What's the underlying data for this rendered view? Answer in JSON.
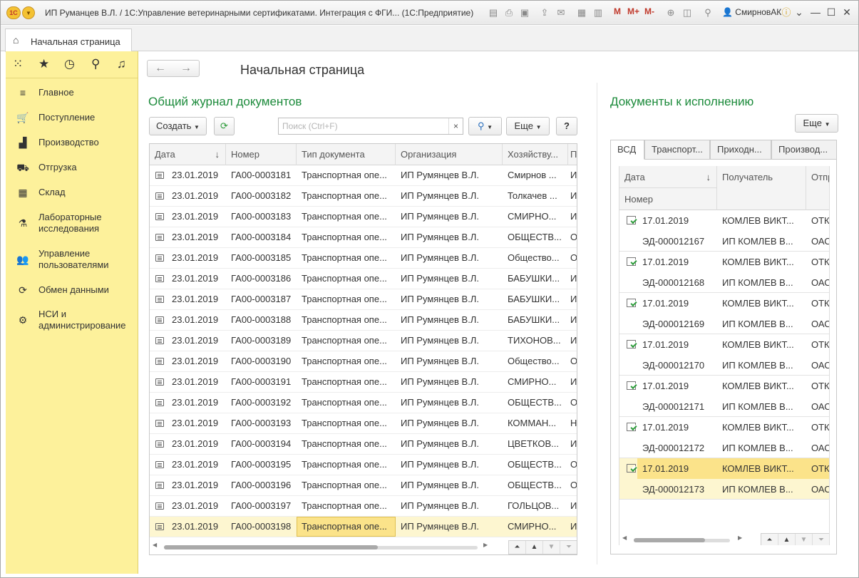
{
  "window": {
    "title": "ИП Руманцев В.Л. / 1С:Управление ветеринарными сертификатами. Интеграция с ФГИ... (1С:Предприятие)",
    "logo": "1С",
    "user": "СмирновАК",
    "toolbar_memory": [
      "M",
      "M+",
      "M-"
    ]
  },
  "tabs": {
    "home_label": "Начальная страница"
  },
  "sidebar": {
    "items": [
      {
        "label": "Главное",
        "icon": "menu-icon"
      },
      {
        "label": "Поступление",
        "icon": "cart-icon"
      },
      {
        "label": "Производство",
        "icon": "factory-icon"
      },
      {
        "label": "Отгрузка",
        "icon": "truck-icon"
      },
      {
        "label": "Склад",
        "icon": "warehouse-icon"
      },
      {
        "label": "Лабораторные исследования",
        "icon": "flask-icon"
      },
      {
        "label": "Управление пользователями",
        "icon": "users-icon"
      },
      {
        "label": "Обмен данными",
        "icon": "sync-icon"
      },
      {
        "label": "НСИ и администрирование",
        "icon": "gear-icon"
      }
    ]
  },
  "main": {
    "page_title": "Начальная страница",
    "journal": {
      "heading": "Общий журнал документов",
      "create_label": "Создать",
      "search_placeholder": "Поиск (Ctrl+F)",
      "more_label": "Еще",
      "help_label": "?",
      "columns": [
        "Дата",
        "Номер",
        "Тип документа",
        "Организация",
        "Хозяйству...",
        "П"
      ],
      "rows": [
        {
          "date": "23.01.2019",
          "number": "ГА00-0003181",
          "type": "Транспортная опе...",
          "org": "ИП Румянцев В.Л.",
          "holder": "Смирнов ...",
          "extra": "И"
        },
        {
          "date": "23.01.2019",
          "number": "ГА00-0003182",
          "type": "Транспортная опе...",
          "org": "ИП Румянцев В.Л.",
          "holder": "Толкачев ...",
          "extra": "И"
        },
        {
          "date": "23.01.2019",
          "number": "ГА00-0003183",
          "type": "Транспортная опе...",
          "org": "ИП Румянцев В.Л.",
          "holder": "СМИРНО...",
          "extra": "И"
        },
        {
          "date": "23.01.2019",
          "number": "ГА00-0003184",
          "type": "Транспортная опе...",
          "org": "ИП Румянцев В.Л.",
          "holder": "ОБЩЕСТВ...",
          "extra": "О"
        },
        {
          "date": "23.01.2019",
          "number": "ГА00-0003185",
          "type": "Транспортная опе...",
          "org": "ИП Румянцев В.Л.",
          "holder": "Общество...",
          "extra": "О"
        },
        {
          "date": "23.01.2019",
          "number": "ГА00-0003186",
          "type": "Транспортная опе...",
          "org": "ИП Румянцев В.Л.",
          "holder": "БАБУШКИ...",
          "extra": "И"
        },
        {
          "date": "23.01.2019",
          "number": "ГА00-0003187",
          "type": "Транспортная опе...",
          "org": "ИП Румянцев В.Л.",
          "holder": "БАБУШКИ...",
          "extra": "И"
        },
        {
          "date": "23.01.2019",
          "number": "ГА00-0003188",
          "type": "Транспортная опе...",
          "org": "ИП Румянцев В.Л.",
          "holder": "БАБУШКИ...",
          "extra": "И"
        },
        {
          "date": "23.01.2019",
          "number": "ГА00-0003189",
          "type": "Транспортная опе...",
          "org": "ИП Румянцев В.Л.",
          "holder": "ТИХОНОВ...",
          "extra": "И"
        },
        {
          "date": "23.01.2019",
          "number": "ГА00-0003190",
          "type": "Транспортная опе...",
          "org": "ИП Румянцев В.Л.",
          "holder": "Общество...",
          "extra": "О"
        },
        {
          "date": "23.01.2019",
          "number": "ГА00-0003191",
          "type": "Транспортная опе...",
          "org": "ИП Румянцев В.Л.",
          "holder": "СМИРНО...",
          "extra": "И"
        },
        {
          "date": "23.01.2019",
          "number": "ГА00-0003192",
          "type": "Транспортная опе...",
          "org": "ИП Румянцев В.Л.",
          "holder": "ОБЩЕСТВ...",
          "extra": "О"
        },
        {
          "date": "23.01.2019",
          "number": "ГА00-0003193",
          "type": "Транспортная опе...",
          "org": "ИП Румянцев В.Л.",
          "holder": "КОММАН...",
          "extra": "Н"
        },
        {
          "date": "23.01.2019",
          "number": "ГА00-0003194",
          "type": "Транспортная опе...",
          "org": "ИП Румянцев В.Л.",
          "holder": "ЦВЕТКОВ...",
          "extra": "И"
        },
        {
          "date": "23.01.2019",
          "number": "ГА00-0003195",
          "type": "Транспортная опе...",
          "org": "ИП Румянцев В.Л.",
          "holder": "ОБЩЕСТВ...",
          "extra": "О"
        },
        {
          "date": "23.01.2019",
          "number": "ГА00-0003196",
          "type": "Транспортная опе...",
          "org": "ИП Румянцев В.Л.",
          "holder": "ОБЩЕСТВ...",
          "extra": "О"
        },
        {
          "date": "23.01.2019",
          "number": "ГА00-0003197",
          "type": "Транспортная опе...",
          "org": "ИП Румянцев В.Л.",
          "holder": "ГОЛЬЦОВ...",
          "extra": "И"
        },
        {
          "date": "23.01.2019",
          "number": "ГА00-0003198",
          "type": "Транспортная опе...",
          "org": "ИП Румянцев В.Л.",
          "holder": "СМИРНО...",
          "extra": "И"
        }
      ]
    },
    "todo": {
      "heading": "Документы к исполнению",
      "more_label": "Еще",
      "tabs": [
        "ВСД",
        "Транспорт...",
        "Приходн...",
        "Производ..."
      ],
      "col_date": "Дата",
      "col_number": "Номер",
      "col_recipient": "Получатель",
      "col_sender": "Отпр",
      "rows": [
        {
          "date": "17.01.2019",
          "number": "ЭД-000012167",
          "recipient": "КОМЛЕВ ВИКТ...",
          "recipient2": "ИП КОМЛЕВ В...",
          "sender": "ОТК",
          "sender2": "ОАС"
        },
        {
          "date": "17.01.2019",
          "number": "ЭД-000012168",
          "recipient": "КОМЛЕВ ВИКТ...",
          "recipient2": "ИП КОМЛЕВ В...",
          "sender": "ОТК",
          "sender2": "ОАС"
        },
        {
          "date": "17.01.2019",
          "number": "ЭД-000012169",
          "recipient": "КОМЛЕВ ВИКТ...",
          "recipient2": "ИП КОМЛЕВ В...",
          "sender": "ОТК",
          "sender2": "ОАС"
        },
        {
          "date": "17.01.2019",
          "number": "ЭД-000012170",
          "recipient": "КОМЛЕВ ВИКТ...",
          "recipient2": "ИП КОМЛЕВ В...",
          "sender": "ОТК",
          "sender2": "ОАС"
        },
        {
          "date": "17.01.2019",
          "number": "ЭД-000012171",
          "recipient": "КОМЛЕВ ВИКТ...",
          "recipient2": "ИП КОМЛЕВ В...",
          "sender": "ОТК",
          "sender2": "ОАС"
        },
        {
          "date": "17.01.2019",
          "number": "ЭД-000012172",
          "recipient": "КОМЛЕВ ВИКТ...",
          "recipient2": "ИП КОМЛЕВ В...",
          "sender": "ОТК",
          "sender2": "ОАС"
        },
        {
          "date": "17.01.2019",
          "number": "ЭД-000012173",
          "recipient": "КОМЛЕВ ВИКТ...",
          "recipient2": "ИП КОМЛЕВ В...",
          "sender": "ОТК",
          "sender2": "ОАС"
        }
      ]
    }
  },
  "colors": {
    "accent_green": "#1b8a3a",
    "sidebar_bg": "#fdf19b",
    "selection": "#fbe38a"
  }
}
